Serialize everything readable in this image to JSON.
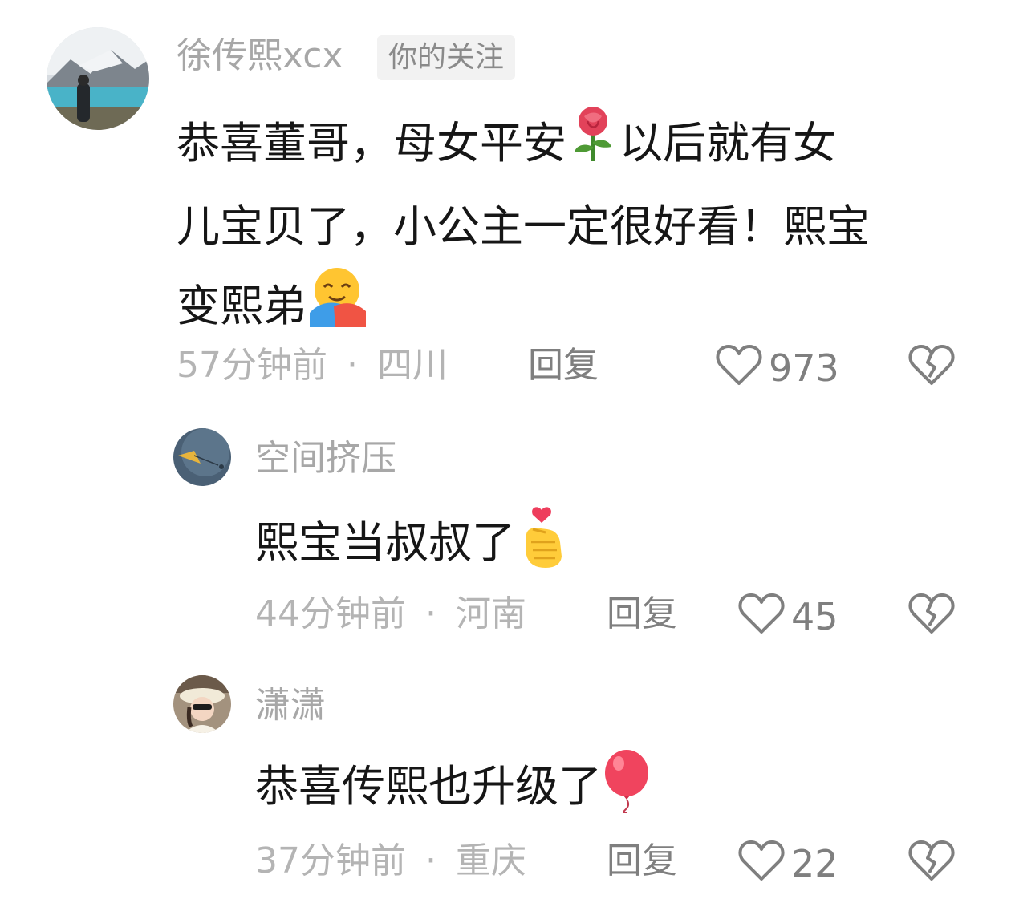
{
  "comments": [
    {
      "username": "徐传熙xcx",
      "badge": "你的关注",
      "content_parts": [
        "恭喜董哥，母女平安",
        "以后就有女",
        "儿宝贝了，小公主一定很好看！熙宝",
        "变熙弟"
      ],
      "emojis": [
        "rose-emoji",
        "hugging-face-emoji"
      ],
      "time": "57分钟前",
      "location": "四川",
      "reply_label": "回复",
      "like_count": "973"
    },
    {
      "username": "空间挤压",
      "content": "熙宝当叔叔了",
      "emojis": [
        "finger-heart-emoji"
      ],
      "time": "44分钟前",
      "location": "河南",
      "reply_label": "回复",
      "like_count": "45"
    },
    {
      "username": "潇潇",
      "content": "恭喜传熙也升级了",
      "emojis": [
        "balloon-emoji"
      ],
      "time": "37分钟前",
      "location": "重庆",
      "reply_label": "回复",
      "like_count": "22"
    }
  ],
  "separator": "·",
  "colors": {
    "username": "#a7a7a7",
    "content": "#161616",
    "meta": "#b4b4b4",
    "action": "#7f7f7f"
  }
}
